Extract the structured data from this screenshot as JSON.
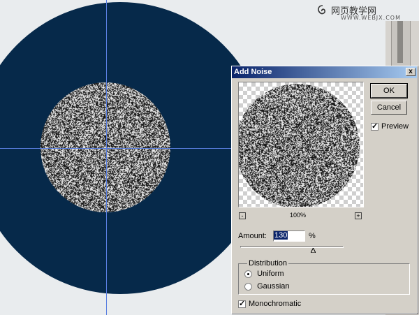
{
  "dialog": {
    "title": "Add Noise",
    "close_label": "x",
    "ok_label": "OK",
    "cancel_label": "Cancel",
    "preview_label": "Preview",
    "preview_checked": true,
    "zoom_minus": "-",
    "zoom_plus": "+",
    "zoom_level": "100%",
    "amount_label": "Amount:",
    "amount_value": "130",
    "amount_unit": "%",
    "amount_slider_fraction": 0.7,
    "distribution_label": "Distribution",
    "distribution_options": [
      "Uniform",
      "Gaussian"
    ],
    "distribution_selected": "Uniform",
    "monochromatic_label": "Monochromatic",
    "monochromatic_checked": true
  },
  "watermark": {
    "text": "网页教学网",
    "url": "WWW.WEBJX.COM"
  },
  "colors": {
    "canvas_background": "#e9ecee",
    "disc_fill": "#06294a",
    "guide_line": "#5a7fe0",
    "dialog_face": "#d4d0c8",
    "titlebar_start": "#0a246a"
  }
}
